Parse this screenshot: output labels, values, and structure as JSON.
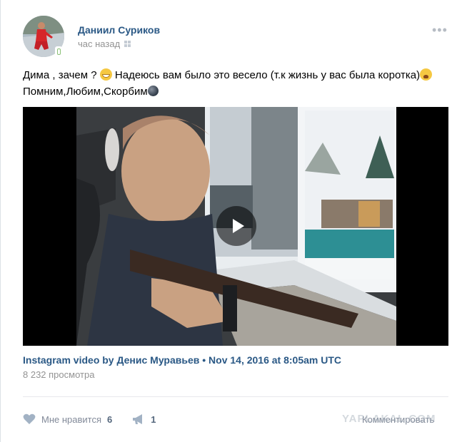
{
  "post": {
    "author": "Даниил Суриков",
    "time": "час назад",
    "text_line1_a": "Дима , зачем ? ",
    "text_line1_b": " Надеюсь вам было это весело (т.к жизнь у вас была коротка)",
    "text_line2": "Помним,Любим,Скорбим",
    "emoji_1": "grinning-sweat-emoji",
    "emoji_2": "weary-face-emoji",
    "emoji_3": "black-circle-emoji"
  },
  "video": {
    "title": "Instagram video by Денис Муравьев • Nov 14, 2016 at 8:05am UTC",
    "views": "8 232 просмотра"
  },
  "actions": {
    "like_label": "Мне нравится",
    "like_count": "6",
    "share_count": "1",
    "comment_label": "Комментировать"
  },
  "watermark": "YAPLAKAL.COM",
  "colors": {
    "link": "#2a5885",
    "meta": "#939393",
    "action": "#828a99",
    "background": "#edeef0"
  }
}
